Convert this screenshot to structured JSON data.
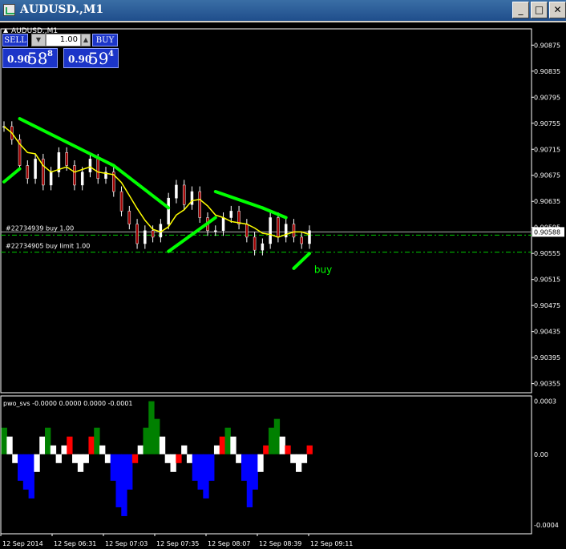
{
  "window": {
    "title": "AUDUSD.,M1",
    "chart_label": "AUDUSD.,M1",
    "buttons": {
      "minimize": "_",
      "maximize": "□",
      "close": "✕"
    }
  },
  "trade_panel": {
    "sell_label": "SELL",
    "buy_label": "BUY",
    "lot": "1.00",
    "sell_price": {
      "prefix": "0.90",
      "big": "58",
      "sup": "8"
    },
    "buy_price": {
      "prefix": "0.90",
      "big": "59",
      "sup": "4"
    }
  },
  "colors": {
    "background": "#000000",
    "candle": "#ffffff",
    "ma": "#ffff00",
    "trend": "#00ff00",
    "order_line": "#00cc00",
    "hist_red": "#ff0000",
    "hist_blue": "#0000ff",
    "hist_green": "#008000",
    "hist_white": "#ffffff"
  },
  "chart_data": [
    {
      "type": "line",
      "title": "AUDUSD.,M1",
      "y_ticks": [
        "0.90875",
        "0.90835",
        "0.90795",
        "0.90755",
        "0.90715",
        "0.90675",
        "0.90635",
        "0.90595",
        "0.90555",
        "0.90515",
        "0.90475",
        "0.90435",
        "0.90395",
        "0.90355"
      ],
      "ylim": [
        0.90341,
        0.909
      ],
      "current_price": "0.90588",
      "x_ticks": [
        "12 Sep 2014",
        "12 Sep 06:31",
        "12 Sep 07:03",
        "12 Sep 07:35",
        "12 Sep 08:07",
        "12 Sep 08:39",
        "12 Sep 09:11"
      ],
      "orders": [
        {
          "label": "#22734939 buy 1.00",
          "price": 0.90588
        },
        {
          "label": "#22734905 buy limit 1.00",
          "price": 0.90557
        }
      ],
      "annotation": "buy",
      "close_series": [
        0.9075,
        0.9073,
        0.9069,
        0.9067,
        0.907,
        0.9066,
        0.9068,
        0.9071,
        0.9069,
        0.9066,
        0.9068,
        0.907,
        0.9067,
        0.9068,
        0.9065,
        0.9062,
        0.906,
        0.9057,
        0.9059,
        0.9058,
        0.906,
        0.9064,
        0.9066,
        0.9063,
        0.9065,
        0.9061,
        0.9059,
        0.9059,
        0.9061,
        0.9062,
        0.906,
        0.9058,
        0.9056,
        0.9057,
        0.9061,
        0.9058,
        0.906,
        0.9058,
        0.9057,
        0.9059
      ]
    },
    {
      "type": "bar",
      "title": "pwo_svs -0.0000 0.0000 0.0000 -0.0001",
      "y_ticks": [
        "0.0003",
        "0.00",
        "-0.0004"
      ],
      "ylim": [
        -0.00045,
        0.00033
      ],
      "values": [
        0.00015,
        0.0001,
        -5e-05,
        -0.00015,
        -0.0002,
        -0.00025,
        -0.0001,
        0.0001,
        0.00015,
        5e-05,
        -5e-05,
        5e-05,
        0.0001,
        -5e-05,
        -0.0001,
        -5e-05,
        0.0001,
        0.00015,
        5e-05,
        -5e-05,
        -0.00015,
        -0.0003,
        -0.00035,
        -0.0002,
        -5e-05,
        5e-05,
        0.00015,
        0.0003,
        0.0002,
        0.0001,
        -5e-05,
        -0.0001,
        -5e-05,
        5e-05,
        -5e-05,
        -0.00015,
        -0.0002,
        -0.00025,
        -0.00015,
        5e-05,
        0.0001,
        0.00015,
        0.0001,
        -5e-05,
        -0.00015,
        -0.0003,
        -0.0002,
        -0.0001,
        5e-05,
        0.00015,
        0.0002,
        0.0001,
        5e-05,
        -5e-05,
        -0.0001,
        -5e-05,
        5e-05
      ]
    }
  ]
}
